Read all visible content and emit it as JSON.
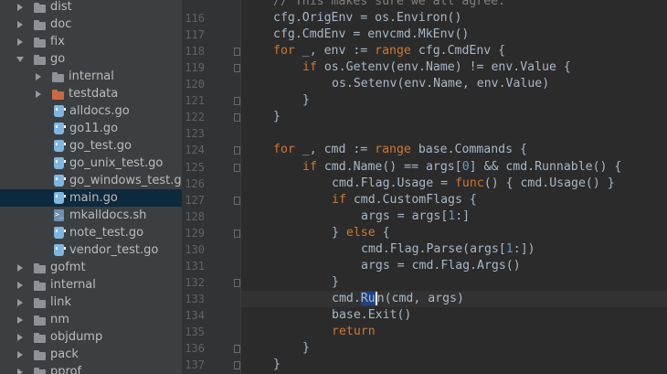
{
  "colors": {
    "sidebar_bg": "#3c3f41",
    "editor_bg": "#2b2b2b",
    "keyword": "#cc7832",
    "number": "#6897bb",
    "text": "#a9b7c6",
    "selected_row": "#0d293e"
  },
  "project_tree": [
    {
      "label": "dist",
      "type": "folder",
      "state": "closed",
      "depth": 0
    },
    {
      "label": "doc",
      "type": "folder",
      "state": "closed",
      "depth": 0
    },
    {
      "label": "fix",
      "type": "folder",
      "state": "closed",
      "depth": 0
    },
    {
      "label": "go",
      "type": "folder",
      "state": "open",
      "depth": 0
    },
    {
      "label": "internal",
      "type": "folder",
      "state": "closed",
      "depth": 1
    },
    {
      "label": "testdata",
      "type": "folder-testdata",
      "state": "closed",
      "depth": 1
    },
    {
      "label": "alldocs.go",
      "type": "go-file",
      "depth": 1
    },
    {
      "label": "go11.go",
      "type": "go-file",
      "depth": 1
    },
    {
      "label": "go_test.go",
      "type": "go-file",
      "depth": 1
    },
    {
      "label": "go_unix_test.go",
      "type": "go-file",
      "depth": 1
    },
    {
      "label": "go_windows_test.go",
      "type": "go-file",
      "depth": 1
    },
    {
      "label": "main.go",
      "type": "go-file",
      "depth": 1,
      "selected": true
    },
    {
      "label": "mkalldocs.sh",
      "type": "sh-file",
      "depth": 1
    },
    {
      "label": "note_test.go",
      "type": "go-file",
      "depth": 1
    },
    {
      "label": "vendor_test.go",
      "type": "go-file",
      "depth": 1
    },
    {
      "label": "gofmt",
      "type": "folder",
      "state": "closed",
      "depth": 0
    },
    {
      "label": "internal",
      "type": "folder",
      "state": "closed",
      "depth": 0
    },
    {
      "label": "link",
      "type": "folder",
      "state": "closed",
      "depth": 0
    },
    {
      "label": "nm",
      "type": "folder",
      "state": "closed",
      "depth": 0
    },
    {
      "label": "objdump",
      "type": "folder",
      "state": "closed",
      "depth": 0
    },
    {
      "label": "pack",
      "type": "folder",
      "state": "closed",
      "depth": 0
    },
    {
      "label": "pprof",
      "type": "folder",
      "state": "closed",
      "depth": 0
    }
  ],
  "code": {
    "current_line": "133",
    "lines": [
      {
        "n": "",
        "indent": 1,
        "tokens": [
          [
            "cmt",
            "// This makes sure we all agree."
          ]
        ]
      },
      {
        "n": "116",
        "indent": 1,
        "tokens": [
          [
            "",
            "cfg.OrigEnv = os.Environ()"
          ]
        ]
      },
      {
        "n": "117",
        "indent": 1,
        "tokens": [
          [
            "",
            "cfg.CmdEnv = envcmd.MkEnv()"
          ]
        ]
      },
      {
        "n": "118",
        "indent": 1,
        "fold": true,
        "tokens": [
          [
            "kw",
            "for"
          ],
          [
            "",
            " _, env := "
          ],
          [
            "kw",
            "range"
          ],
          [
            "",
            " cfg.CmdEnv {"
          ]
        ]
      },
      {
        "n": "119",
        "indent": 2,
        "fold": true,
        "tokens": [
          [
            "kw",
            "if"
          ],
          [
            "",
            " os.Getenv(env.Name) != env.Value {"
          ]
        ]
      },
      {
        "n": "120",
        "indent": 3,
        "tokens": [
          [
            "",
            "os.Setenv(env.Name, env.Value)"
          ]
        ]
      },
      {
        "n": "121",
        "indent": 2,
        "fold": true,
        "tokens": [
          [
            "",
            "}"
          ]
        ]
      },
      {
        "n": "122",
        "indent": 1,
        "fold": true,
        "tokens": [
          [
            "",
            "}"
          ]
        ]
      },
      {
        "n": "123",
        "indent": 1,
        "tokens": []
      },
      {
        "n": "124",
        "indent": 1,
        "fold": true,
        "tokens": [
          [
            "kw",
            "for"
          ],
          [
            "",
            " _, cmd := "
          ],
          [
            "kw",
            "range"
          ],
          [
            "",
            " base.Commands {"
          ]
        ]
      },
      {
        "n": "125",
        "indent": 2,
        "fold": true,
        "tokens": [
          [
            "kw",
            "if"
          ],
          [
            "",
            " cmd.Name() == args["
          ],
          [
            "num",
            "0"
          ],
          [
            "",
            "] && cmd.Runnable() {"
          ]
        ]
      },
      {
        "n": "126",
        "indent": 3,
        "tokens": [
          [
            "",
            "cmd.Flag.Usage = "
          ],
          [
            "kw",
            "func"
          ],
          [
            "",
            "() { cmd.Usage() }"
          ]
        ]
      },
      {
        "n": "127",
        "indent": 3,
        "fold": true,
        "tokens": [
          [
            "kw",
            "if"
          ],
          [
            "",
            " cmd.CustomFlags {"
          ]
        ]
      },
      {
        "n": "128",
        "indent": 4,
        "tokens": [
          [
            "",
            "args = args["
          ],
          [
            "num",
            "1"
          ],
          [
            "",
            ":]"
          ]
        ]
      },
      {
        "n": "129",
        "indent": 3,
        "fold": true,
        "tokens": [
          [
            "",
            "} "
          ],
          [
            "kw",
            "else"
          ],
          [
            "",
            " {"
          ]
        ]
      },
      {
        "n": "130",
        "indent": 4,
        "tokens": [
          [
            "",
            "cmd.Flag.Parse(args["
          ],
          [
            "num",
            "1"
          ],
          [
            "",
            ":])"
          ]
        ]
      },
      {
        "n": "131",
        "indent": 4,
        "tokens": [
          [
            "",
            "args = cmd.Flag.Args()"
          ]
        ]
      },
      {
        "n": "132",
        "indent": 3,
        "fold": true,
        "tokens": [
          [
            "",
            "}"
          ]
        ]
      },
      {
        "n": "133",
        "indent": 3,
        "tokens": [
          [
            "",
            "cmd."
          ],
          [
            "sel",
            "Ru"
          ],
          [
            "",
            "n(cmd, args)"
          ]
        ]
      },
      {
        "n": "134",
        "indent": 3,
        "tokens": [
          [
            "",
            "base.Exit()"
          ]
        ]
      },
      {
        "n": "135",
        "indent": 3,
        "tokens": [
          [
            "kw",
            "return"
          ]
        ]
      },
      {
        "n": "136",
        "indent": 2,
        "fold": true,
        "tokens": [
          [
            "",
            "}"
          ]
        ]
      },
      {
        "n": "137",
        "indent": 1,
        "fold": true,
        "tokens": [
          [
            "",
            "}"
          ]
        ]
      }
    ]
  }
}
